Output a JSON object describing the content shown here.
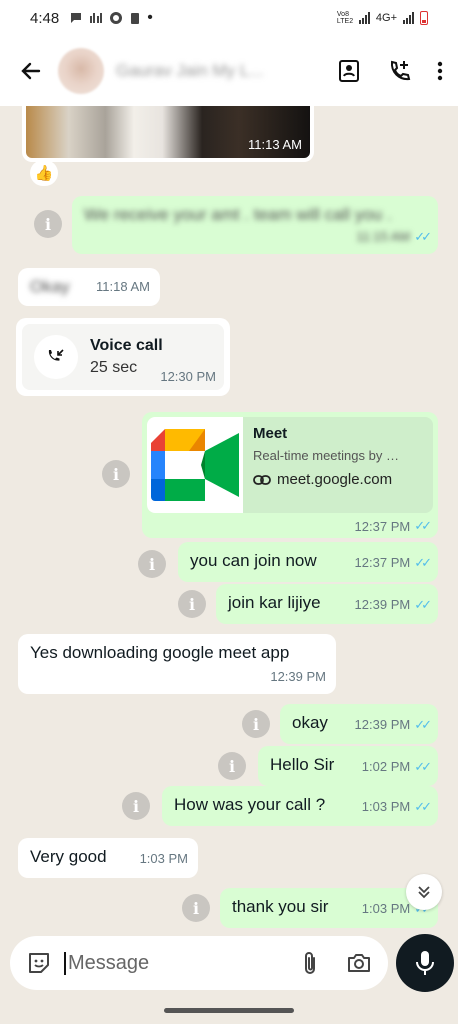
{
  "status_bar": {
    "time": "4:48",
    "network_label": "4G+",
    "volte_label": "Vo8 LTE2"
  },
  "header": {
    "contact_name": "Gaurav Jain My L...",
    "icons": [
      "back-arrow-icon",
      "contact-card-icon",
      "add-call-icon",
      "more-vert-icon"
    ]
  },
  "messages": [
    {
      "type": "image",
      "time": "11:13 AM",
      "reaction": "👍"
    },
    {
      "type": "out",
      "text": "We receive your amt . team will call you .",
      "time": "11:15 AM",
      "ticks": "✓✓"
    },
    {
      "type": "in",
      "text": "Okay",
      "time": "11:18 AM"
    },
    {
      "type": "call",
      "title": "Voice call",
      "duration": "25 sec",
      "time": "12:30 PM"
    },
    {
      "type": "link",
      "link_title": "Meet",
      "link_desc": "Real-time meetings by …",
      "link_url": "meet.google.com",
      "time": "12:37 PM",
      "ticks": "✓✓"
    },
    {
      "type": "out",
      "text": "you can join now",
      "time": "12:37 PM",
      "ticks": "✓✓"
    },
    {
      "type": "out",
      "text": "join kar lijiye",
      "time": "12:39 PM",
      "ticks": "✓✓"
    },
    {
      "type": "in",
      "text": "Yes downloading google meet app",
      "time": "12:39 PM"
    },
    {
      "type": "out",
      "text": "okay",
      "time": "12:39 PM",
      "ticks": "✓✓"
    },
    {
      "type": "out",
      "text": "Hello Sir",
      "time": "1:02 PM",
      "ticks": "✓✓"
    },
    {
      "type": "out",
      "text": "How was your call ?",
      "time": "1:03 PM",
      "ticks": "✓✓"
    },
    {
      "type": "in",
      "text": "Very good",
      "time": "1:03 PM"
    },
    {
      "type": "out",
      "text": "thank you sir",
      "time": "1:03 PM",
      "ticks": "✓✓"
    }
  ],
  "composer": {
    "placeholder": "Message",
    "icons": [
      "sticker-icon",
      "attach-icon",
      "camera-icon",
      "mic-icon"
    ]
  },
  "colors": {
    "outgoing_bubble": "#d9fdd3",
    "incoming_bubble": "#ffffff",
    "chat_background": "#efeae2",
    "read_ticks": "#53bdeb"
  }
}
